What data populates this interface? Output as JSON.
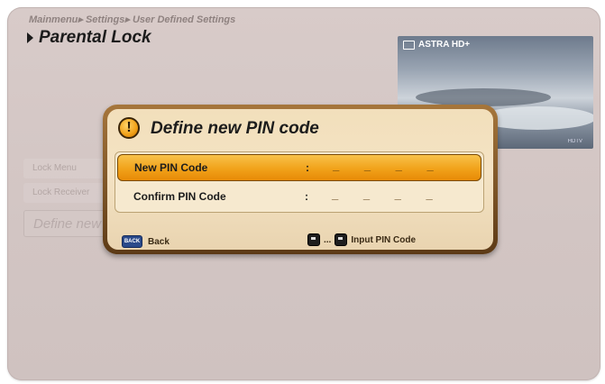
{
  "header": {
    "breadcrumb": "Mainmenu▸ Settings▸ User Defined Settings",
    "title": "Parental Lock"
  },
  "preview": {
    "channel": "ASTRA HD+",
    "caption": "HDTV"
  },
  "background_menu": {
    "items": [
      "Lock Menu",
      "Lock Receiver",
      "Define new PIN code"
    ]
  },
  "dialog": {
    "title": "Define new PIN code",
    "fields": [
      {
        "label": "New PIN Code",
        "colon": ":",
        "value": "_ _ _ _",
        "selected": true
      },
      {
        "label": "Confirm PIN Code",
        "colon": ":",
        "value": "_ _ _ _",
        "selected": false
      }
    ],
    "footer": {
      "back_key": "BACK",
      "back_label": "Back",
      "range_separator": "...",
      "input_label": "Input PIN Code"
    }
  },
  "colors": {
    "panel_bg": "#d6c9c7",
    "dialog_border": "#7a5224",
    "dialog_bg": "#f2dfbb",
    "selected_row": "#f1a21a"
  }
}
